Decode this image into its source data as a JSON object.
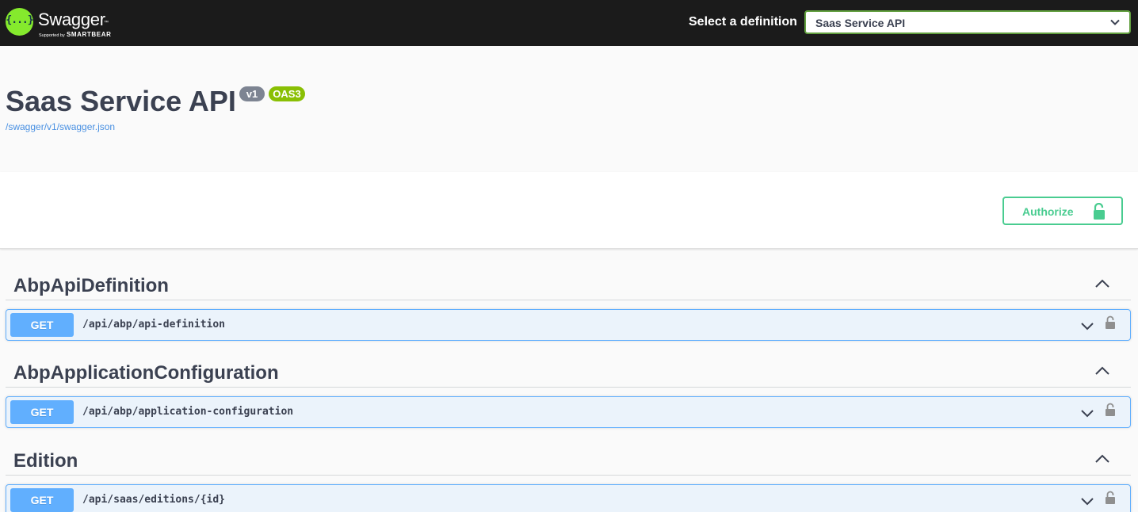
{
  "topbar": {
    "logo": {
      "icon_text": "{...}",
      "name": "Swagger",
      "trademark": "™",
      "supported_by": "Supported by",
      "company": "SMARTBEAR"
    },
    "select_label": "Select a definition",
    "selected_definition": "Saas Service API",
    "background_color": "#1b1b1b",
    "accent_color": "#85ea2d"
  },
  "info": {
    "title": "Saas Service API",
    "version_badge": "v1",
    "oas_badge": "OAS3",
    "spec_url": "/swagger/v1/swagger.json"
  },
  "auth": {
    "authorize_label": "Authorize",
    "icon": "unlocked-padlock-icon",
    "color": "#49cc90"
  },
  "tags": [
    {
      "name": "AbpApiDefinition",
      "operations": [
        {
          "method": "GET",
          "path": "/api/abp/api-definition"
        }
      ]
    },
    {
      "name": "AbpApplicationConfiguration",
      "operations": [
        {
          "method": "GET",
          "path": "/api/abp/application-configuration"
        }
      ]
    },
    {
      "name": "Edition",
      "operations": [
        {
          "method": "GET",
          "path": "/api/saas/editions/{id}"
        }
      ]
    }
  ],
  "colors": {
    "get_method": "#61affe",
    "get_background": "#ebf3fb"
  }
}
